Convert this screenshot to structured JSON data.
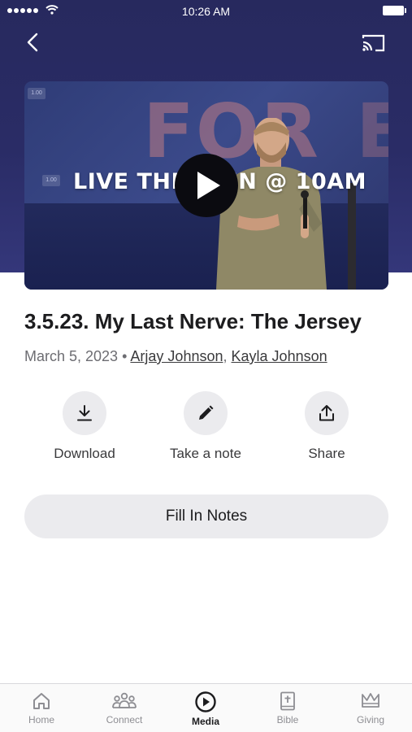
{
  "status_bar": {
    "time": "10:26 AM"
  },
  "video": {
    "overlay_text": "LIVE THIS SUN @ 10AM",
    "background_text": "FOR",
    "tag": "1.00"
  },
  "sermon": {
    "title": "3.5.23. My Last Nerve: The Jersey",
    "date": "March 5, 2023",
    "separator": "•",
    "speakers": [
      "Arjay Johnson",
      "Kayla Johnson"
    ],
    "speaker_separator": ","
  },
  "actions": [
    {
      "label": "Download",
      "icon": "download-icon"
    },
    {
      "label": "Take a note",
      "icon": "pencil-icon"
    },
    {
      "label": "Share",
      "icon": "share-icon"
    }
  ],
  "fill_notes_label": "Fill In Notes",
  "tabs": [
    {
      "label": "Home",
      "icon": "home-icon",
      "active": false
    },
    {
      "label": "Connect",
      "icon": "people-icon",
      "active": false
    },
    {
      "label": "Media",
      "icon": "play-circle-icon",
      "active": true
    },
    {
      "label": "Bible",
      "icon": "bible-icon",
      "active": false
    },
    {
      "label": "Giving",
      "icon": "crown-icon",
      "active": false
    }
  ],
  "colors": {
    "hero": "#27295e",
    "button_bg": "#ebebee",
    "text_dark": "#1c1c1e",
    "text_muted": "#6d6d72",
    "tab_inactive": "#8e8e93"
  }
}
